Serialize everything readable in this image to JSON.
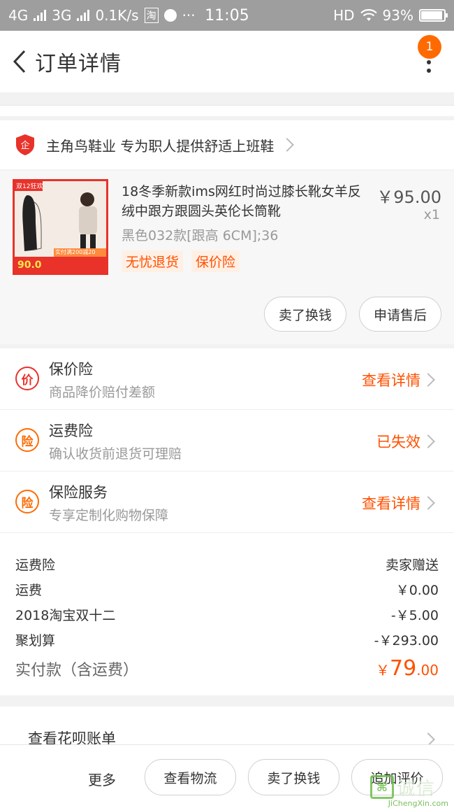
{
  "status_bar": {
    "net1": "4G",
    "net2": "3G",
    "speed": "0.1K/s",
    "app_tag": "淘",
    "dots": "···",
    "time": "11:05",
    "hd": "HD",
    "battery": "93%"
  },
  "header": {
    "title": "订单详情",
    "badge_count": "1"
  },
  "shop": {
    "name": "主角鸟鞋业 专为职人提供舒适上班鞋"
  },
  "product": {
    "title": "18冬季新款ims网红时尚过膝长靴女羊反绒中跟方跟圆头英伦长筒靴",
    "price": "￥95.00",
    "qty": "x1",
    "sku": "黑色032款[跟高 6CM];36",
    "tags": [
      "无忧退货",
      "保价险"
    ],
    "buttons": [
      "卖了换钱",
      "申请售后"
    ],
    "thumb_badge": "双12狂欢",
    "thumb_price": "90.0",
    "thumb_coupon": "实付满200减20"
  },
  "insurance": [
    {
      "icon": "价",
      "title": "保价险",
      "subtitle": "商品降价赔付差额",
      "action": "查看详情",
      "color": "red"
    },
    {
      "icon": "险",
      "title": "运费险",
      "subtitle": "确认收货前退货可理赔",
      "action": "已失效",
      "color": "orange"
    },
    {
      "icon": "险",
      "title": "保险服务",
      "subtitle": "专享定制化购物保障",
      "action": "查看详情",
      "color": "orange"
    }
  ],
  "fees": [
    {
      "label": "运费险",
      "value": "卖家赠送"
    },
    {
      "label": "运费",
      "value": "￥0.00"
    },
    {
      "label": "2018淘宝双十二",
      "value": "-￥5.00"
    },
    {
      "label": "聚划算",
      "value": "-￥293.00"
    }
  ],
  "total": {
    "label": "实付款（含运费）",
    "currency": "￥",
    "integer": "79",
    "decimal": ".00"
  },
  "huabei": {
    "label": "查看花呗账单"
  },
  "bottom_bar": {
    "more": "更多",
    "buttons": [
      "查看物流",
      "卖了换钱",
      "追加评价"
    ]
  },
  "watermark": {
    "text": "诚信",
    "url": "JiChengXin.com"
  },
  "colors": {
    "accent": "#ff5000",
    "badge": "#ff6a00",
    "shop_icon": "#e8322a",
    "status_bar": "#9e9e9e"
  }
}
